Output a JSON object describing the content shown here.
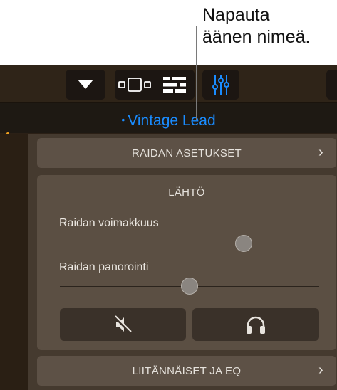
{
  "callout": {
    "text": "Napauta\näänen nimeä."
  },
  "toolbar": {
    "buttons": [
      {
        "icon": "dropdown-triangle-icon"
      },
      {
        "icon": "track-view-icon"
      },
      {
        "icon": "list-view-icon"
      },
      {
        "icon": "mixer-sliders-icon",
        "active": true
      }
    ]
  },
  "patch": {
    "dot": "•",
    "name": "Vintage Lead",
    "color": "#1a8cff"
  },
  "sections": {
    "track_settings": {
      "label": "RAIDAN ASETUKSET",
      "chevron": "›"
    },
    "output": {
      "title": "LÄHTÖ",
      "volume": {
        "label": "Raidan voimakkuus",
        "value": 0.71
      },
      "pan": {
        "label": "Raidan panorointi",
        "value": 0.5
      },
      "mute_icon": "mute-speaker-icon",
      "solo_icon": "headphones-icon"
    },
    "plugins_eq": {
      "label": "LIITÄNNÄISET JA EQ",
      "chevron": "›"
    }
  }
}
